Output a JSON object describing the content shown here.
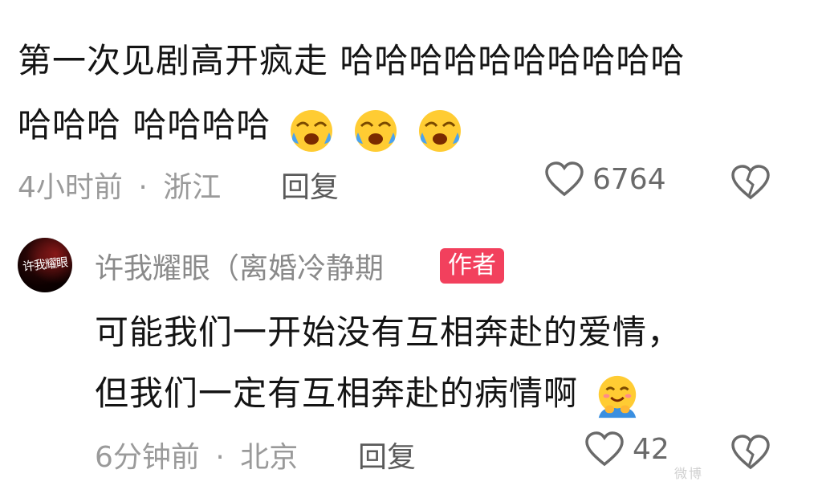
{
  "comment": {
    "line1": "第一次见剧高开疯走 哈哈哈哈哈哈哈哈哈哈",
    "line2": "哈哈哈 哈哈哈哈",
    "emojis": [
      "crying-laughing-icon",
      "crying-laughing-icon",
      "crying-laughing-icon"
    ],
    "time": "4小时前",
    "separator": "·",
    "location": "浙江",
    "reply_label": "回复",
    "like_count": "6764"
  },
  "reply": {
    "username": "许我耀眼（离婚冷静期",
    "avatar_text": "许我耀眼",
    "badge": "作者",
    "line1": "可能我们一开始没有互相奔赴的爱情，",
    "line2": "但我们一定有互相奔赴的病情啊",
    "emoji": "hugging-face-icon",
    "time": "6分钟前",
    "separator": "·",
    "location": "北京",
    "reply_label": "回复",
    "like_count": "42"
  },
  "watermark": "微博"
}
